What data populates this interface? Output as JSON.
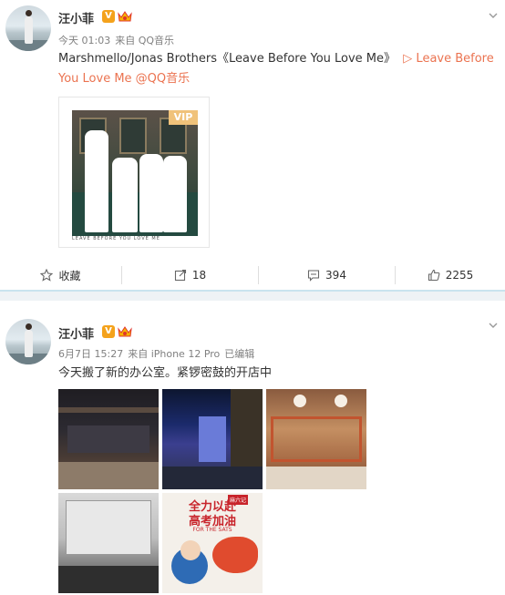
{
  "posts": [
    {
      "author": "汪小菲",
      "verified_badge": "V",
      "time": "今天 01:03",
      "source": "来自 QQ音乐",
      "text_main": "Marshmello/Jonas Brothers《Leave Before You Love Me》",
      "link_text": "▷ Leave Before You Love Me @QQ音乐",
      "album": {
        "vip_label": "VIP",
        "cover_caption": "LEAVE BEFORE YOU LOVE ME"
      },
      "actions": {
        "favorite": "收藏",
        "repost": "18",
        "comment": "394",
        "like": "2255"
      }
    },
    {
      "author": "汪小菲",
      "verified_badge": "V",
      "time": "6月7日 15:27",
      "source": "来自 iPhone 12 Pro",
      "edited": "已编辑",
      "text_main": "今天搬了新的办公室。紧锣密鼓的开店中",
      "poster_text_1": "全力以赴",
      "poster_text_2": "高考加油",
      "poster_text_3": "FOR THE SATS",
      "poster_logo": "麻六记"
    }
  ],
  "colors": {
    "link": "#eb7350",
    "badge": "#f4a21c",
    "divider": "#c9e3ee"
  }
}
